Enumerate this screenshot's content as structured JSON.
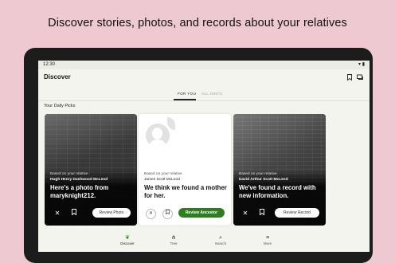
{
  "promo": {
    "headline": "Discover stories, photos, and records about your relatives"
  },
  "status_bar": {
    "time": "12:30"
  },
  "app_bar": {
    "title": "Discover"
  },
  "tabs": [
    {
      "label": "FOR YOU",
      "active": true
    },
    {
      "label": "ALL HINTS",
      "active": false
    }
  ],
  "section_title": "Your Daily Picks",
  "cards": [
    {
      "based_on": "Based on your relative",
      "relative": "Hugh Henry Dashwood McLeod",
      "headline": "Here's a photo from maryknight212.",
      "button": "Review Photo"
    },
    {
      "based_on": "Based on your relative",
      "relative": "James Scott McLeod",
      "headline": "We think we found a mother for her.",
      "button": "Review Ancestor"
    },
    {
      "based_on": "Based on your relative",
      "relative": "David Arthur Scott McLeod",
      "headline": "We've found a record with new information.",
      "button": "Review Record"
    }
  ],
  "bottom_nav": [
    {
      "label": "Discover",
      "icon": "leaf-icon",
      "active": true
    },
    {
      "label": "Tree",
      "icon": "tree-icon",
      "active": false
    },
    {
      "label": "Search",
      "icon": "search-icon",
      "active": false
    },
    {
      "label": "More",
      "icon": "menu-icon",
      "active": false
    }
  ],
  "colors": {
    "background": "#efc9d2",
    "accent_green": "#2e7d1f",
    "screen": "#f4f4ef"
  }
}
